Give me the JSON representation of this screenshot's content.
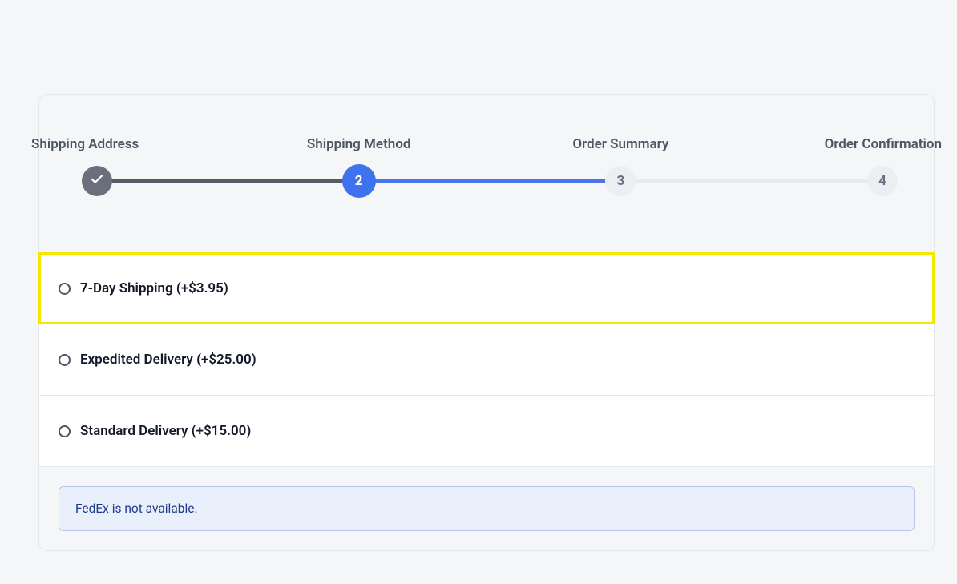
{
  "stepper": {
    "steps": [
      {
        "label": "Shipping Address",
        "num": "1",
        "state": "done"
      },
      {
        "label": "Shipping Method",
        "num": "2",
        "state": "active"
      },
      {
        "label": "Order Summary",
        "num": "3",
        "state": "upcoming"
      },
      {
        "label": "Order Confirmation",
        "num": "4",
        "state": "upcoming"
      }
    ]
  },
  "shipping_options": [
    {
      "label": "7-Day Shipping (+$3.95)",
      "highlighted": true
    },
    {
      "label": "Expedited Delivery (+$25.00)",
      "highlighted": false
    },
    {
      "label": "Standard Delivery (+$15.00)",
      "highlighted": false
    }
  ],
  "alert": {
    "message": "FedEx is not available."
  }
}
